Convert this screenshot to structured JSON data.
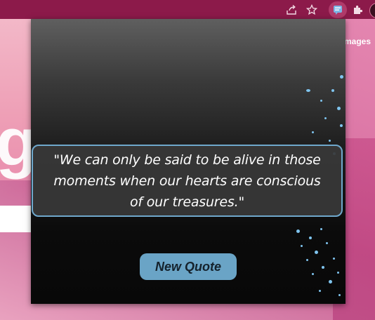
{
  "background_page": {
    "logo_letter": "g",
    "images_link": "mages"
  },
  "popup": {
    "quote": "\"We can only be said to be alive in those moments when our hearts are conscious of our treasures.\"",
    "new_quote_label": "New Quote"
  },
  "colors": {
    "accent": "#6aa4c6",
    "toolbar": "#8c1a4a",
    "quote_border": "#6fa8cc"
  }
}
